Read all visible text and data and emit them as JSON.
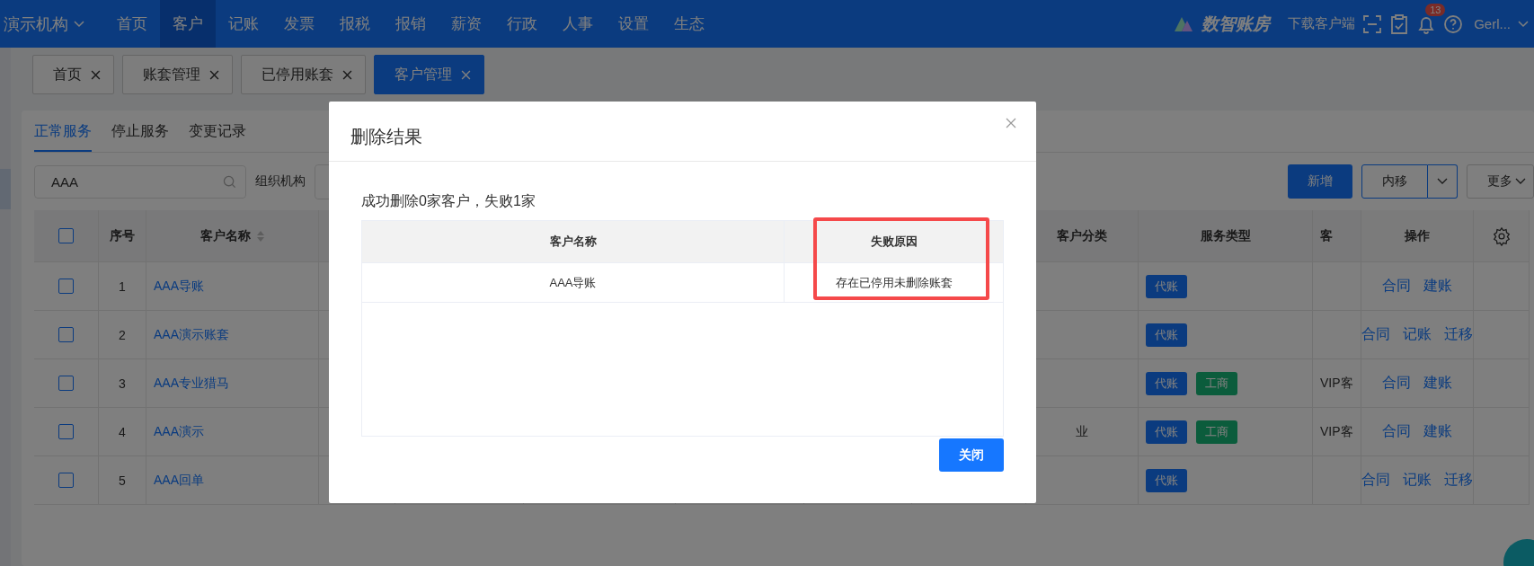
{
  "topbar": {
    "org": "演示机构",
    "nav": [
      {
        "label": "首页",
        "selected": false
      },
      {
        "label": "客户",
        "selected": true
      },
      {
        "label": "记账",
        "selected": false
      },
      {
        "label": "发票",
        "selected": false
      },
      {
        "label": "报税",
        "selected": false
      },
      {
        "label": "报销",
        "selected": false
      },
      {
        "label": "薪资",
        "selected": false
      },
      {
        "label": "行政",
        "selected": false
      },
      {
        "label": "人事",
        "selected": false
      },
      {
        "label": "设置",
        "selected": false
      },
      {
        "label": "生态",
        "selected": false
      }
    ],
    "brand": "数智账房",
    "download": "下载客户端",
    "badge": "13",
    "user": "Gerl..."
  },
  "page_tabs": [
    {
      "label": "首页",
      "selected": false
    },
    {
      "label": "账套管理",
      "selected": false
    },
    {
      "label": "已停用账套",
      "selected": false
    },
    {
      "label": "客户管理",
      "selected": true
    }
  ],
  "sub_tabs": [
    {
      "label": "正常服务",
      "selected": true
    },
    {
      "label": "停止服务",
      "selected": false
    },
    {
      "label": "变更记录",
      "selected": false
    }
  ],
  "search": {
    "value": "AAA"
  },
  "org_filter": {
    "label": "组织机构"
  },
  "buttons": {
    "add": "新增",
    "move": "内移",
    "more": "更多"
  },
  "table": {
    "header_checked": false,
    "columns": [
      "序号",
      "客户名称",
      "客户分类",
      "服务类型",
      "客",
      "操作"
    ],
    "rows": [
      {
        "checked": false,
        "index": "1",
        "name": "AAA导账",
        "tags": [
          {
            "label": "代账",
            "kind": "bookkeeping"
          }
        ],
        "actions": [
          "合同",
          "建账"
        ]
      },
      {
        "checked": false,
        "index": "2",
        "name": "AAA演示账套",
        "tags": [
          {
            "label": "代账",
            "kind": "bookkeeping"
          }
        ],
        "actions": [
          "合同",
          "记账",
          "迁移"
        ]
      },
      {
        "checked": false,
        "index": "3",
        "name": "AAA专业猎马",
        "tags": [
          {
            "label": "代账",
            "kind": "bookkeeping"
          },
          {
            "label": "工商",
            "kind": "registration"
          }
        ],
        "level_text": "VIP客",
        "actions": [
          "合同",
          "建账"
        ]
      },
      {
        "checked": false,
        "index": "4",
        "name": "AAA演示",
        "category": "业",
        "tags": [
          {
            "label": "代账",
            "kind": "bookkeeping"
          },
          {
            "label": "工商",
            "kind": "registration"
          }
        ],
        "level_text": "VIP客",
        "actions": [
          "合同",
          "建账"
        ]
      },
      {
        "checked": false,
        "index": "5",
        "name": "AAA回单",
        "tags": [
          {
            "label": "代账",
            "kind": "bookkeeping"
          }
        ],
        "actions": [
          "合同",
          "记账",
          "迁移"
        ]
      }
    ]
  },
  "modal": {
    "title": "删除结果",
    "message": "成功删除0家客户，失败1家",
    "columns": [
      {
        "label": "客户名称",
        "highlighted": false
      },
      {
        "label": "失败原因",
        "highlighted": true
      }
    ],
    "rows": [
      [
        "AAA导账",
        "存在已停用未删除账套"
      ]
    ],
    "button": "关闭"
  }
}
